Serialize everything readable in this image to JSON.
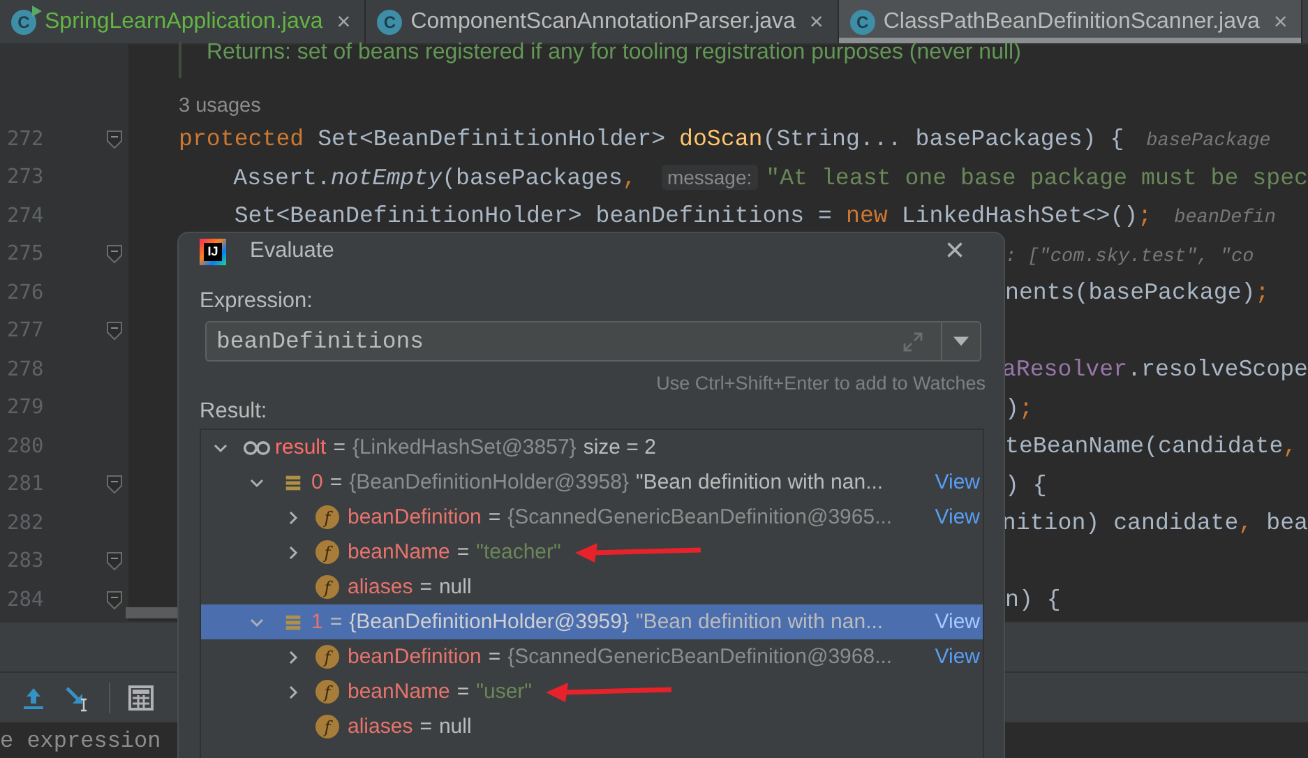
{
  "tabs": [
    {
      "label": "SpringLearnApplication.java",
      "icon_letter": "C",
      "kind": "runnable",
      "color": "#62b543",
      "selected": false,
      "close": "×"
    },
    {
      "label": "ComponentScanAnnotationParser.java",
      "icon_letter": "C",
      "kind": "class",
      "color": "#bbbbbb",
      "selected": false,
      "close": "×"
    },
    {
      "label": "ClassPathBeanDefinitionScanner.java",
      "icon_letter": "C",
      "kind": "class",
      "color": "#bbbbbb",
      "selected": true,
      "close": "×"
    }
  ],
  "editor": {
    "doc": "Returns: set of beans registered if any for tooling registration purposes (never null)",
    "usages": "3 usages",
    "lines": [
      {
        "number": "272",
        "fold": true,
        "kind": "full",
        "tokens": [
          {
            "t": "protected ",
            "kind": "kw"
          },
          {
            "t": "Set<BeanDefinitionHolder> ",
            "kind": "plain"
          },
          {
            "t": "doScan",
            "kind": "method"
          },
          {
            "t": "(String... basePackages) {",
            "kind": "plain"
          },
          {
            "t": "basePackage",
            "kind": "hint"
          }
        ]
      },
      {
        "number": "273",
        "fold": false,
        "kind": "full",
        "tokens": [
          {
            "t": "    Assert.",
            "kind": "plain"
          },
          {
            "t": "notEmpty",
            "kind": "static"
          },
          {
            "t": "(basePackages",
            "kind": "plain"
          },
          {
            "t": ", ",
            "kind": "kw"
          },
          {
            "t": "message:",
            "kind": "param"
          },
          {
            "t": "\"At least one base package must be spec",
            "kind": "str"
          }
        ]
      },
      {
        "number": "274",
        "fold": false,
        "kind": "full",
        "tokens": [
          {
            "t": "    Set<BeanDefinitionHolder> beanDefinitions = ",
            "kind": "plain"
          },
          {
            "t": "new ",
            "kind": "kw"
          },
          {
            "t": "LinkedHashSet<>()",
            "kind": "plain"
          },
          {
            "t": ";",
            "kind": "kw"
          },
          {
            "t": "beanDefin",
            "kind": "hint"
          }
        ]
      },
      {
        "number": "275",
        "fold": true,
        "kind": "tail",
        "tokens": [
          {
            "t": ": [\"com.sky.test\", \"co",
            "kind": "hint"
          }
        ]
      },
      {
        "number": "276",
        "fold": false,
        "kind": "tail",
        "tokens": [
          {
            "t": "nents(basePackage)",
            "kind": "plain"
          },
          {
            "t": ";",
            "kind": "kw"
          }
        ]
      },
      {
        "number": "277",
        "fold": true
      },
      {
        "number": "278",
        "fold": false,
        "kind": "tail",
        "tokens": [
          {
            "t": "aResolver",
            "kind": "field"
          },
          {
            "t": ".resolveScope",
            "kind": "plain"
          }
        ]
      },
      {
        "number": "279",
        "fold": false,
        "kind": "tail",
        "tokens": [
          {
            "t": ")",
            "kind": "plain"
          },
          {
            "t": ";",
            "kind": "kw"
          }
        ]
      },
      {
        "number": "280",
        "fold": false,
        "kind": "tail",
        "tokens": [
          {
            "t": "teBeanName(candidate",
            "kind": "plain"
          },
          {
            "t": ",",
            "kind": "kw"
          }
        ]
      },
      {
        "number": "281",
        "fold": true,
        "kind": "tail",
        "tokens": [
          {
            "t": ") {",
            "kind": "plain"
          }
        ]
      },
      {
        "number": "282",
        "fold": false,
        "kind": "tail",
        "tokens": [
          {
            "t": "nition) candidate",
            "kind": "plain"
          },
          {
            "t": ", ",
            "kind": "kw"
          },
          {
            "t": "bea",
            "kind": "plain"
          }
        ]
      },
      {
        "number": "283",
        "fold": true
      },
      {
        "number": "284",
        "fold": true,
        "kind": "tail",
        "tokens": [
          {
            "t": "n) {",
            "kind": "plain"
          }
        ]
      }
    ]
  },
  "bottom": {
    "console_text": "e expression"
  },
  "dialog": {
    "title": "Evaluate",
    "logo_text": "IJ",
    "close": "×",
    "expression_label": "Expression:",
    "expression": "beanDefinitions",
    "hint": "Use Ctrl+Shift+Enter to add to Watches",
    "result_label": "Result:",
    "tree": [
      {
        "name": "result",
        "kind": "watch",
        "expanded": true,
        "selected": false,
        "value": [
          {
            "t": "=",
            "kind": "plain"
          },
          {
            "t": "{LinkedHashSet@3857}",
            "kind": "ref"
          },
          {
            "t": "size = 2",
            "kind": "plain"
          }
        ],
        "children": [
          {
            "name": "0",
            "kind": "array",
            "expanded": true,
            "selected": false,
            "value": [
              {
                "t": "=",
                "kind": "plain"
              },
              {
                "t": "{BeanDefinitionHolder@3958}",
                "kind": "ref"
              },
              {
                "t": "\"Bean definition with nan...",
                "kind": "plain"
              }
            ],
            "link": "View",
            "children": [
              {
                "name": "beanDefinition",
                "kind": "field",
                "icon_text": "f",
                "expanded": false,
                "selected": false,
                "value": [
                  {
                    "t": "=",
                    "kind": "plain"
                  },
                  {
                    "t": "{ScannedGenericBeanDefinition@3965...",
                    "kind": "ref"
                  }
                ],
                "link": "View"
              },
              {
                "name": "beanName",
                "kind": "field",
                "icon_text": "f",
                "expanded": false,
                "selected": false,
                "value": [
                  {
                    "t": "=",
                    "kind": "plain"
                  },
                  {
                    "t": "\"teacher\"",
                    "kind": "str"
                  }
                ],
                "marked": true
              },
              {
                "name": "aliases",
                "kind": "field",
                "icon_text": "f",
                "selected": false,
                "value": [
                  {
                    "t": "=",
                    "kind": "plain"
                  },
                  {
                    "t": "null",
                    "kind": "plain"
                  }
                ]
              }
            ]
          },
          {
            "name": "1",
            "kind": "array",
            "expanded": true,
            "selected": true,
            "value": [
              {
                "t": "=",
                "kind": "plain"
              },
              {
                "t": "{BeanDefinitionHolder@3959}",
                "kind": "ref"
              },
              {
                "t": "\"Bean definition with nan...",
                "kind": "plain"
              }
            ],
            "link": "View",
            "children": [
              {
                "name": "beanDefinition",
                "kind": "field",
                "icon_text": "f",
                "expanded": false,
                "selected": false,
                "value": [
                  {
                    "t": "=",
                    "kind": "plain"
                  },
                  {
                    "t": "{ScannedGenericBeanDefinition@3968...",
                    "kind": "ref"
                  }
                ],
                "link": "View"
              },
              {
                "name": "beanName",
                "kind": "field",
                "icon_text": "f",
                "expanded": false,
                "selected": false,
                "value": [
                  {
                    "t": "=",
                    "kind": "plain"
                  },
                  {
                    "t": "\"user\"",
                    "kind": "str"
                  }
                ],
                "marked": true
              },
              {
                "name": "aliases",
                "kind": "field",
                "icon_text": "f",
                "selected": false,
                "value": [
                  {
                    "t": "=",
                    "kind": "plain"
                  },
                  {
                    "t": "null",
                    "kind": "plain"
                  }
                ]
              }
            ]
          }
        ]
      }
    ]
  }
}
